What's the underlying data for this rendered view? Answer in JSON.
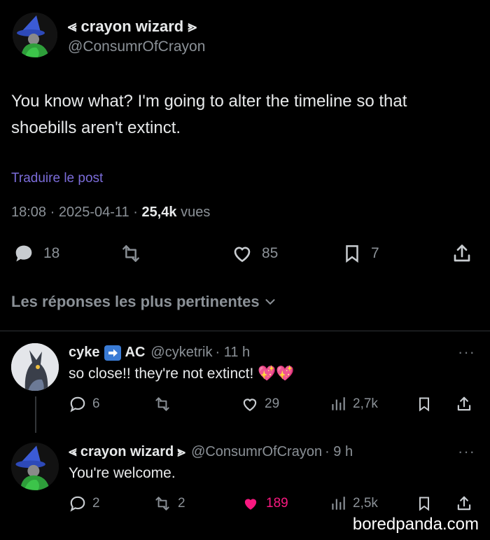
{
  "post": {
    "display_name": "⪡ crayon wizard ⪢",
    "handle": "@ConsumrOfCrayon",
    "text": "You know what? I'm going to alter the timeline so that shoebills aren't extinct.",
    "translate_label": "Traduire le post",
    "time": "18:08",
    "date": "2025-04-11",
    "views_count": "25,4k",
    "views_label": "vues",
    "replies": "18",
    "likes": "85",
    "bookmarks": "7"
  },
  "sort_label": "Les réponses les plus pertinentes",
  "replies": [
    {
      "display_name": "cyke",
      "name_suffix": "AC",
      "handle": "@cyketrik",
      "time": "· 11 h",
      "text": "so close!! they're not extinct! 💖💖",
      "replies": "6",
      "reposts": "",
      "likes": "29",
      "views": "2,7k"
    },
    {
      "display_name": "⪡ crayon wizard ⪢",
      "handle": "@ConsumrOfCrayon",
      "time": "· 9 h",
      "text": "You're welcome.",
      "replies": "2",
      "reposts": "2",
      "likes": "189",
      "views": "2,5k"
    }
  ],
  "watermark": "boredpanda.com",
  "colors": {
    "background": "#000000",
    "text": "#e7e9ea",
    "muted": "#8b9197",
    "link": "#7b6cd9",
    "like_active": "#f91880"
  }
}
